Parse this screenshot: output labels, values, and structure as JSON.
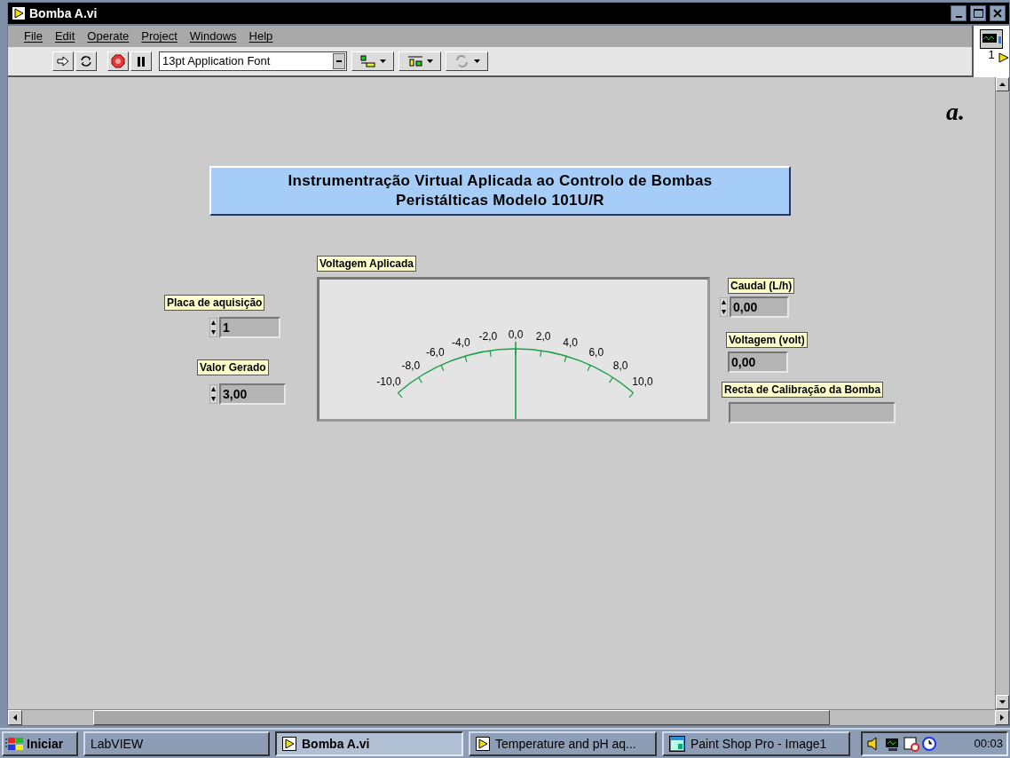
{
  "window": {
    "title": "Bomba A.vi"
  },
  "menu": [
    "File",
    "Edit",
    "Operate",
    "Project",
    "Windows",
    "Help"
  ],
  "toolbar": {
    "font": "13pt Application Font",
    "tools": [
      {
        "kind": "align",
        "disabled": false
      },
      {
        "kind": "distribute",
        "disabled": false
      },
      {
        "kind": "reorder",
        "disabled": true
      }
    ]
  },
  "connector_pane": {
    "label": "1"
  },
  "panel": {
    "corner_label": "a.",
    "heading": [
      "Instrumentração Virtual Aplicada ao Controlo de Bombas",
      "Peristálticas Modelo 101U/R"
    ],
    "meter": {
      "label": "Voltagem Aplicada",
      "level": 0.5,
      "scale": [
        "-10,0",
        "-8,0",
        "-6,0",
        "-4,0",
        "-2,0",
        "0,0",
        "2,0",
        "4,0",
        "6,0",
        "8,0",
        "10,0"
      ]
    },
    "controls": [
      {
        "kind": "control",
        "label": "Placa de aquisição",
        "value": "1"
      },
      {
        "kind": "control",
        "label": "Valor Gerado",
        "value": "3,00"
      },
      {
        "kind": "control",
        "label": "Caudal (L/h)",
        "value": "0,00"
      },
      {
        "kind": "indicator",
        "label": "Voltagem (volt)",
        "value": "0,00"
      },
      {
        "kind": "indicator",
        "label": "Recta de Calibração da Bomba"
      }
    ]
  },
  "taskbar": {
    "start": "Iniciar",
    "items": [
      {
        "label": "LabVIEW",
        "selected": false,
        "kind": "plain"
      },
      {
        "label": "Bomba A.vi",
        "selected": true,
        "kind": "vi"
      },
      {
        "label": "Temperature and pH aq...",
        "selected": false,
        "kind": "vi"
      },
      {
        "label": "Paint Shop Pro - Image1",
        "selected": false,
        "kind": "paint"
      }
    ],
    "clock": "00:03"
  }
}
